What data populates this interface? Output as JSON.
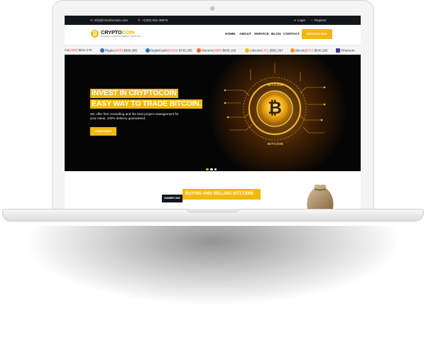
{
  "topbar": {
    "email": "info@YourDomain.com",
    "phone": "+(333) 052 39876",
    "login": "Login",
    "register": "Register"
  },
  "logo": {
    "name_a": "CRYPTO",
    "name_b": "COIN",
    "symbol": "₿",
    "tagline": "BUSINESS & CRYPTOCURRENCY TEMPLATE"
  },
  "menu": [
    "HOME",
    "ABOUT",
    "SERVICE",
    "BLOG",
    "CONTACT"
  ],
  "register_button": "REGISTER NOW",
  "ticker": [
    {
      "name": "sion",
      "symbol": "(ARK)",
      "price": "$611.278",
      "color": "#f2b90c"
    },
    {
      "name": "Ripple",
      "symbol": "(XRP)",
      "price": "$095.385",
      "color": "#2a6fb5"
    },
    {
      "name": "DigitalCash",
      "symbol": "(DASH)",
      "price": "$745.285",
      "color": "#1c75bc"
    },
    {
      "name": "Monero",
      "symbol": "(XMR)",
      "price": "$835.193",
      "color": "#f26822"
    },
    {
      "name": "Litecoin",
      "symbol": "(LTC)",
      "price": "$381.067",
      "color": "#f2b90c"
    },
    {
      "name": "Bitcoin",
      "symbol": "(BTC)",
      "price": "$545.285",
      "color": "#f7931a"
    },
    {
      "name": "Ethereum",
      "symbol": "",
      "price": "",
      "color": "#3c3c8c"
    }
  ],
  "hero": {
    "line1": "INVEST IN CRYPTOCOIN",
    "line2": "EASY WAY TO TRADE BITCOIN.",
    "description": "We offer free consulting and the best project management for your ideas, 100% delivery guaranteed.",
    "button": "LEARN MORE",
    "coin_label_top": "BITCOIN",
    "coin_label_bottom": "BITCOIN",
    "coin_symbol": "₿",
    "slides": 3,
    "active_slide": 1
  },
  "section": {
    "badge": "NUMBER ONE",
    "title": "BUYING AND SELLING BITCOINS"
  },
  "colors": {
    "accent": "#f2b90c",
    "dark": "#12151c",
    "hero_bg": "#050505"
  }
}
